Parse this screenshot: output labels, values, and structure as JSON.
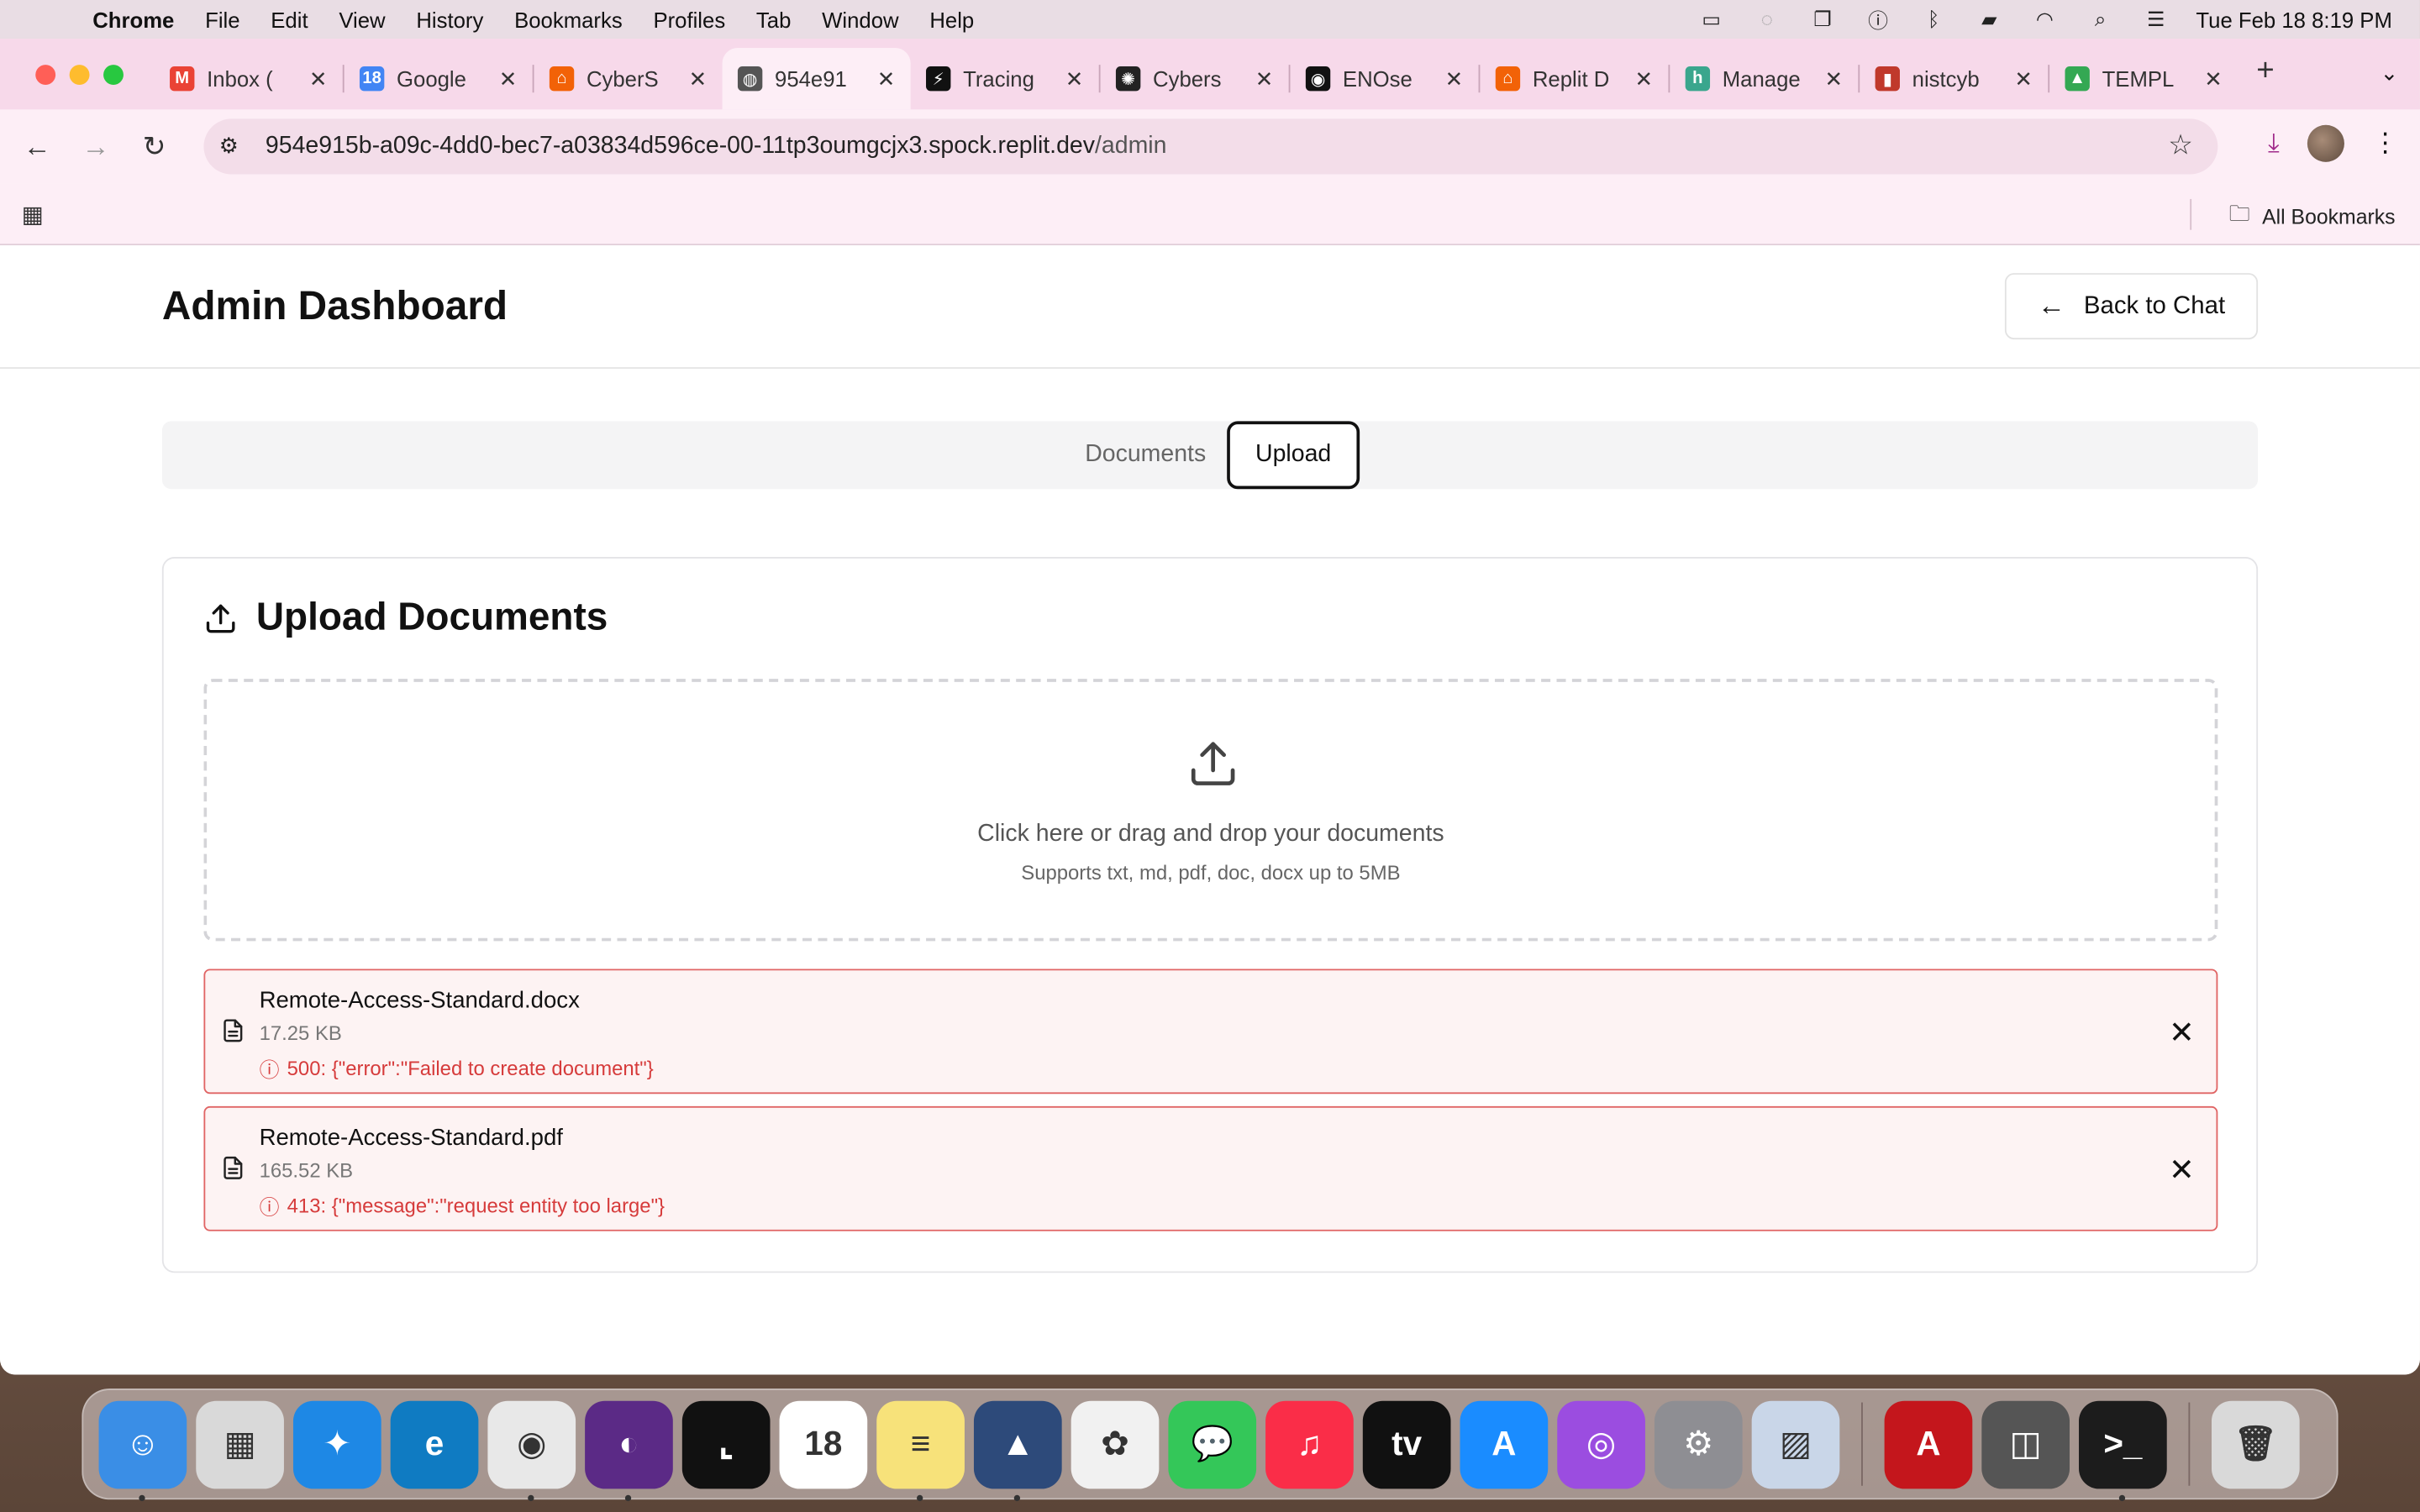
{
  "menubar": {
    "app": "Chrome",
    "items": [
      "File",
      "Edit",
      "View",
      "History",
      "Bookmarks",
      "Profiles",
      "Tab",
      "Window",
      "Help"
    ],
    "datetime": "Tue Feb 18  8:19 PM"
  },
  "browser": {
    "tabs": [
      {
        "title": "Inbox (",
        "icon": "gmail-icon",
        "color": "#ea4335",
        "glyph": "M"
      },
      {
        "title": "Google",
        "icon": "google-calendar-icon",
        "color": "#4285f4",
        "glyph": "18"
      },
      {
        "title": "CyberS",
        "icon": "replit-icon",
        "color": "#f26207",
        "glyph": "⌂"
      },
      {
        "title": "954e91",
        "icon": "globe-icon",
        "color": "#555555",
        "glyph": "◍",
        "active": true
      },
      {
        "title": "Tracing",
        "icon": "tracing-icon",
        "color": "#111111",
        "glyph": "⚡"
      },
      {
        "title": "Cybers",
        "icon": "openai-icon",
        "color": "#222222",
        "glyph": "✺"
      },
      {
        "title": "ENOse",
        "icon": "enose-icon",
        "color": "#111111",
        "glyph": "◉"
      },
      {
        "title": "Replit D",
        "icon": "replit-icon",
        "color": "#f26207",
        "glyph": "⌂"
      },
      {
        "title": "Manage",
        "icon": "h-icon",
        "color": "#3aa68d",
        "glyph": "h"
      },
      {
        "title": "nistcyb",
        "icon": "chart-icon",
        "color": "#c0392b",
        "glyph": "▮"
      },
      {
        "title": "TEMPL",
        "icon": "drive-icon",
        "color": "#34a853",
        "glyph": "▲"
      }
    ],
    "url_host": "954e915b-a09c-4dd0-bec7-a03834d596ce-00-11tp3oumgcjx3.spock.replit.dev",
    "url_path": "/admin",
    "all_bookmarks": "All Bookmarks"
  },
  "page": {
    "title": "Admin Dashboard",
    "back_label": "Back to Chat",
    "tabs": {
      "documents": "Documents",
      "upload": "Upload"
    },
    "card_title": "Upload Documents",
    "dropzone": {
      "main": "Click here or drag and drop your documents",
      "sub": "Supports txt, md, pdf, doc, docx up to 5MB"
    },
    "files": [
      {
        "name": "Remote-Access-Standard.docx",
        "size": "17.25 KB",
        "error": "500: {\"error\":\"Failed to create document\"}"
      },
      {
        "name": "Remote-Access-Standard.pdf",
        "size": "165.52 KB",
        "error": "413: {\"message\":\"request entity too large\"}"
      }
    ]
  },
  "dock": [
    {
      "name": "finder-icon",
      "color": "#3a8ee6",
      "glyph": "☺",
      "running": true
    },
    {
      "name": "launchpad-icon",
      "color": "#d9d9d9",
      "glyph": "▦",
      "running": false
    },
    {
      "name": "safari-icon",
      "color": "#1e88e5",
      "glyph": "✦",
      "running": false
    },
    {
      "name": "edge-icon",
      "color": "#0f7bc2",
      "glyph": "e",
      "running": false
    },
    {
      "name": "chrome-icon",
      "color": "#e8e8e8",
      "glyph": "◉",
      "running": true
    },
    {
      "name": "firefox-icon",
      "color": "#5b2a86",
      "glyph": "◐",
      "running": true
    },
    {
      "name": "screenshot-icon",
      "color": "#111111",
      "glyph": "⌞",
      "running": false
    },
    {
      "name": "calendar-icon",
      "color": "#ffffff",
      "glyph": "18",
      "running": false
    },
    {
      "name": "notes-icon",
      "color": "#f7e27a",
      "glyph": "≡",
      "running": true
    },
    {
      "name": "codeium-icon",
      "color": "#2d4a7a",
      "glyph": "▲",
      "running": true
    },
    {
      "name": "photos-icon",
      "color": "#f1f1f1",
      "glyph": "✿",
      "running": false
    },
    {
      "name": "messages-icon",
      "color": "#34c759",
      "glyph": "💬",
      "running": false
    },
    {
      "name": "music-icon",
      "color": "#fa2d48",
      "glyph": "♫",
      "running": false
    },
    {
      "name": "appletv-icon",
      "color": "#111111",
      "glyph": "tv",
      "running": false
    },
    {
      "name": "appstore-icon",
      "color": "#1a8cff",
      "glyph": "A",
      "running": false
    },
    {
      "name": "podcasts-icon",
      "color": "#9b4de0",
      "glyph": "◎",
      "running": false
    },
    {
      "name": "settings-icon",
      "color": "#8e8e93",
      "glyph": "⚙",
      "running": false
    },
    {
      "name": "preview-icon",
      "color": "#c9d6e8",
      "glyph": "▨",
      "running": false
    },
    {
      "name": "acrobat-icon",
      "color": "#c4161c",
      "glyph": "A",
      "running": false
    },
    {
      "name": "image-capture-icon",
      "color": "#555555",
      "glyph": "◫",
      "running": false
    },
    {
      "name": "terminal-icon",
      "color": "#1c1c1c",
      "glyph": ">_",
      "running": true
    },
    {
      "name": "trash-icon",
      "color": "#d9d9d9",
      "glyph": "🗑",
      "running": false
    }
  ]
}
